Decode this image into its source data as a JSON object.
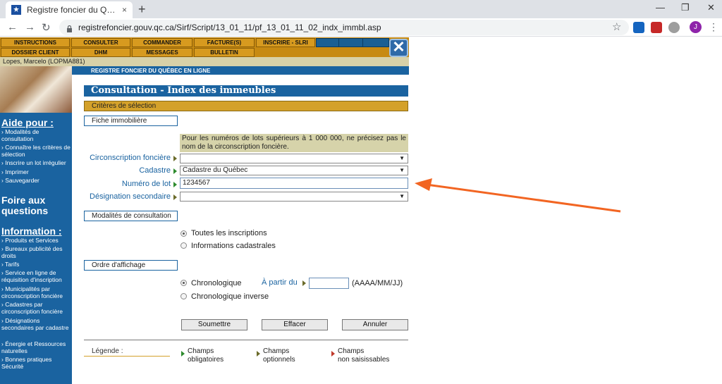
{
  "browser": {
    "tab_title": "Registre foncier du Québec en ligne",
    "close_glyph": "×",
    "newtab_glyph": "+",
    "url": "registrefoncier.gouv.qc.ca/Sirf/Script/13_01_11/pf_13_01_11_02_indx_immbl.asp",
    "avatar_letter": "J",
    "win": {
      "min": "—",
      "max": "❐",
      "close": "✕"
    },
    "back": "←",
    "forward": "→",
    "reload": "↻",
    "star": "☆",
    "kebab": "⋮"
  },
  "menu": {
    "row1": [
      "INSTRUCTIONS",
      "CONSULTER",
      "COMMANDER",
      "FACTURE(S)",
      "INSCRIRE - SLRI"
    ],
    "row2": [
      "DOSSIER CLIENT",
      "DHM",
      "MESSAGES",
      "BULLETIN"
    ],
    "close_glyph": "✕"
  },
  "user": "Lopes, Marcelo (LOPMA881)",
  "banner": "REGISTRE FONCIER DU QUÉBEC EN LIGNE",
  "sidebar": {
    "aide_title": "Aide pour :",
    "aide_items": [
      "Modalités de consultation",
      "Connaître les critères de sélection",
      "Inscrire un lot irrégulier",
      "Imprimer",
      "Sauvegarder"
    ],
    "faq_title": "Foire aux questions",
    "info_title": "Information :",
    "info_items": [
      "Produits et Services",
      "Bureaux publicité des droits",
      "Tarifs",
      "Service en ligne de réquisition d'inscription",
      "Municipalités par circonscription foncière",
      "Cadastres par circonscription foncière",
      "Désignations secondaires par cadastre",
      "Énergie et Ressources naturelles",
      "Bonnes pratiques Sécurité"
    ],
    "bullet": "›"
  },
  "page": {
    "title": "Consultation - Index des immeubles",
    "criteria": "Critères de sélection",
    "fiche": "Fiche immobilière",
    "note": "Pour les numéros de lots supérieurs à 1 000 000, ne précisez pas le nom de la circonscription foncière.",
    "fields": {
      "circonscription_label": "Circonscription foncière",
      "circonscription_value": "",
      "cadastre_label": "Cadastre",
      "cadastre_value": "Cadastre du Québec",
      "lot_label": "Numéro de lot",
      "lot_value": "1234567",
      "designation_label": "Désignation secondaire",
      "designation_value": "",
      "caret": "▼"
    },
    "modalites": "Modalités de consultation",
    "radio_all": "Toutes les inscriptions",
    "radio_cadastral": "Informations cadastrales",
    "ordre": "Ordre d'affichage",
    "radio_chrono": "Chronologique",
    "a_partir_du": "À partir du",
    "date_format": "(AAAA/MM/JJ)",
    "radio_chrono_inv": "Chronologique inverse",
    "btn_submit": "Soumettre",
    "btn_clear": "Effacer",
    "btn_cancel": "Annuler",
    "legend_label": "Légende :",
    "legend_required": [
      "Champs",
      "obligatoires"
    ],
    "legend_optional": [
      "Champs",
      "optionnels"
    ],
    "legend_readonly": [
      "Champs",
      "non saisissables"
    ]
  },
  "colors": {
    "accent": "#1a63a0",
    "gold": "#d4a12a",
    "annotation": "#f26522"
  }
}
